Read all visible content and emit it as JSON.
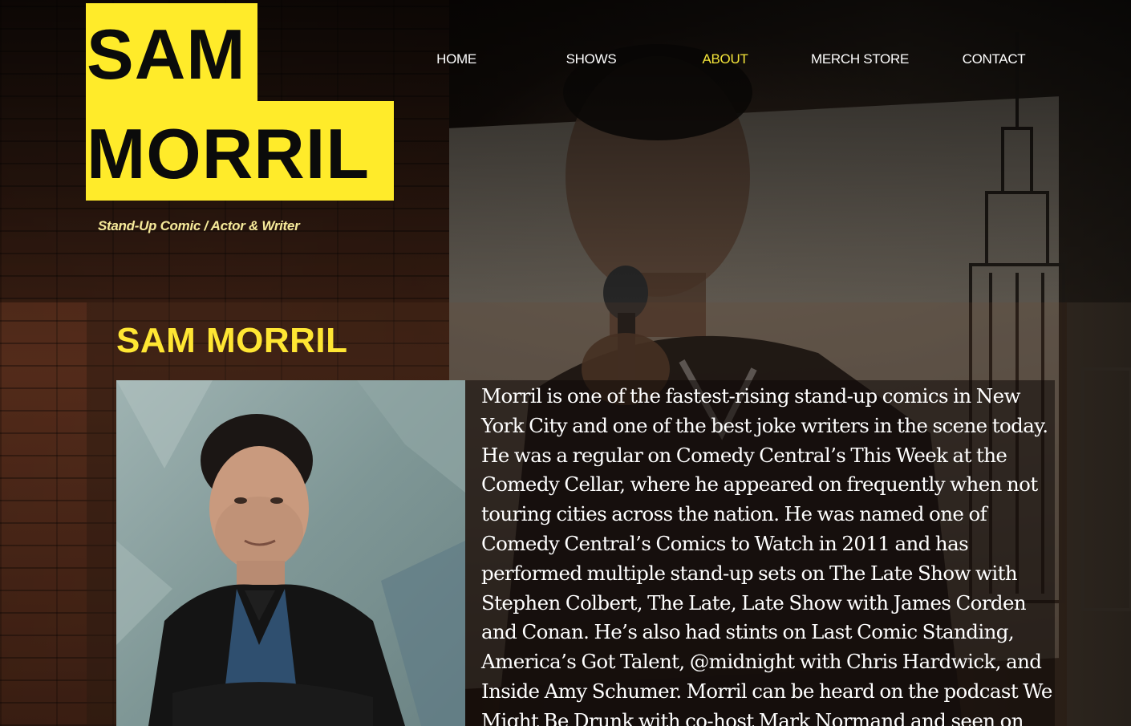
{
  "logo": {
    "line1": "SAM",
    "line2": "MORRIL",
    "tagline": "Stand-Up Comic /  Actor & Writer",
    "accent_color": "#ffeb2a"
  },
  "nav": {
    "items": [
      {
        "label": "HOME",
        "active": false
      },
      {
        "label": "SHOWS",
        "active": false
      },
      {
        "label": "ABOUT",
        "active": true
      },
      {
        "label": "MERCH STORE",
        "active": false
      },
      {
        "label": "CONTACT",
        "active": false
      }
    ],
    "active_color": "#f4e53a"
  },
  "about": {
    "title": "SAM MORRIL",
    "bio": "Morril is one of the fastest-rising stand-up comics in New York City and one of the best joke writers in the scene today. He was a regular on Comedy Central’s This Week at the Comedy Cellar, where he appeared on frequently when not touring cities across the nation. He was named one of Comedy Central’s Comics to Watch in 2011 and has performed multiple stand-up sets on The Late Show with Stephen Colbert, The Late, Late Show with James Corden and Conan. He’s also had stints on Last Comic Standing, America’s Got Talent, @midnight with Chris Hardwick, and Inside Amy Schumer. Morril can be heard on the podcast We Might Be Drunk with co-host Mark Normand and seen on"
  }
}
